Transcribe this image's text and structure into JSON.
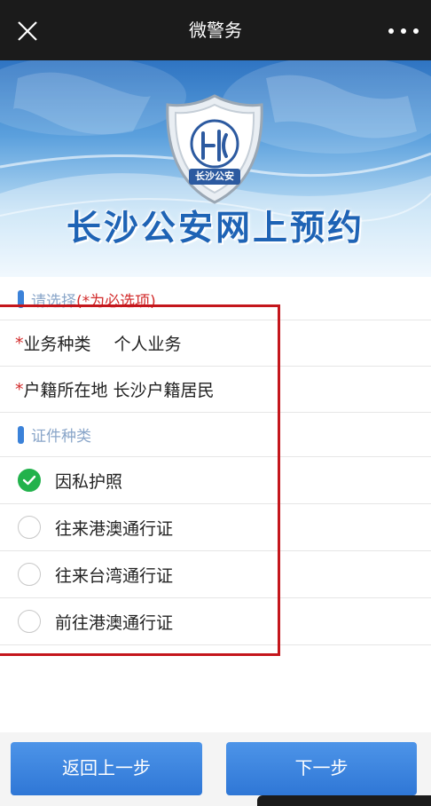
{
  "topbar": {
    "title": "微警务",
    "close_icon": "close-icon",
    "more_icon": "more-dots-icon"
  },
  "banner": {
    "logo_text": "长沙公安",
    "heading": "长沙公安网上预约"
  },
  "form": {
    "section_select": {
      "hint": "请选择",
      "required_note": "(*为必选项)"
    },
    "fields": [
      {
        "star": "*",
        "label": "业务种类",
        "value": "个人业务"
      },
      {
        "star": "*",
        "label": "户籍所在地",
        "value": "长沙户籍居民"
      }
    ],
    "section_docs": {
      "hint": "证件种类"
    },
    "doc_options": [
      {
        "label": "因私护照",
        "checked": true
      },
      {
        "label": "往来港澳通行证",
        "checked": false
      },
      {
        "label": "往来台湾通行证",
        "checked": false
      },
      {
        "label": "前往港澳通行证",
        "checked": false
      }
    ]
  },
  "buttons": {
    "back_label": "返回上一步",
    "next_label": "下一步"
  },
  "colors": {
    "accent_blue": "#3b82d9",
    "required_red": "#d22b2b",
    "check_green": "#22b24c",
    "highlight_red": "#c4161c"
  }
}
